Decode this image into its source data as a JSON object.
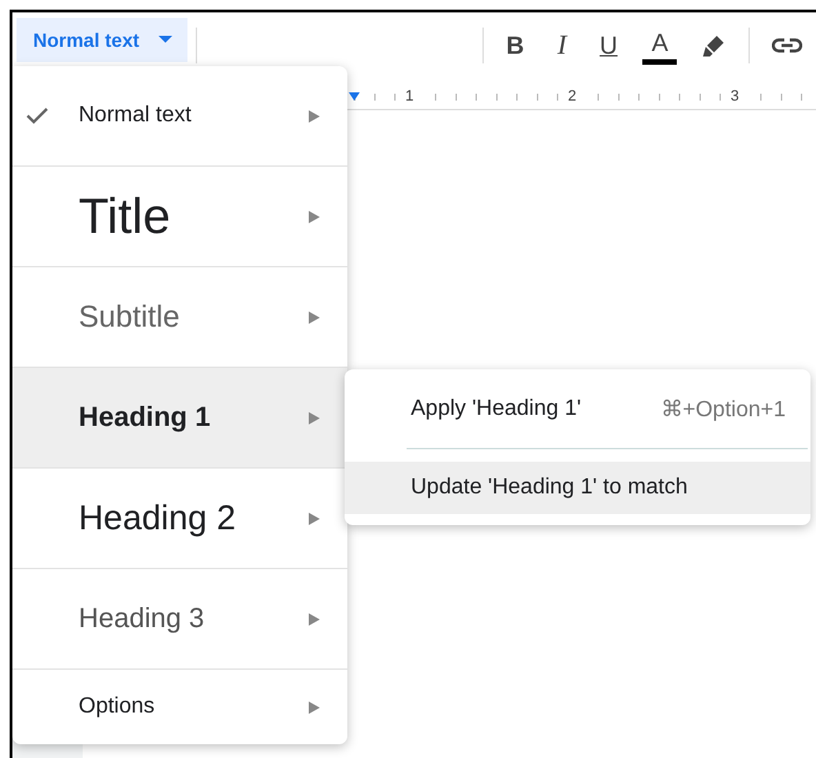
{
  "toolbar": {
    "style_dropdown": {
      "label": "Normal text",
      "expanded": true
    },
    "format_buttons": [
      {
        "kind": "bold",
        "label": "B"
      },
      {
        "kind": "italic",
        "label": "I"
      },
      {
        "kind": "underline",
        "label": "U"
      },
      {
        "kind": "text-color",
        "label": "A",
        "color": "#000000"
      },
      {
        "kind": "highlight"
      },
      {
        "kind": "link"
      }
    ]
  },
  "ruler": {
    "numbers": [
      "1",
      "2",
      "3"
    ]
  },
  "style_menu": {
    "items": [
      {
        "kind": "normal",
        "label": "Normal text",
        "checked": true,
        "selected": false
      },
      {
        "kind": "title",
        "label": "Title",
        "checked": false,
        "selected": false
      },
      {
        "kind": "subtitle",
        "label": "Subtitle",
        "checked": false,
        "selected": false
      },
      {
        "kind": "heading1",
        "label": "Heading 1",
        "checked": false,
        "selected": true
      },
      {
        "kind": "heading2",
        "label": "Heading 2",
        "checked": false,
        "selected": false
      },
      {
        "kind": "heading3",
        "label": "Heading 3",
        "checked": false,
        "selected": false
      },
      {
        "kind": "options",
        "label": "Options",
        "checked": false,
        "selected": false
      }
    ]
  },
  "submenu": {
    "items": [
      {
        "label": "Apply 'Heading 1'",
        "shortcut": "⌘+Option+1",
        "selected": false
      },
      {
        "label": "Update 'Heading 1' to match",
        "selected": true
      }
    ]
  }
}
